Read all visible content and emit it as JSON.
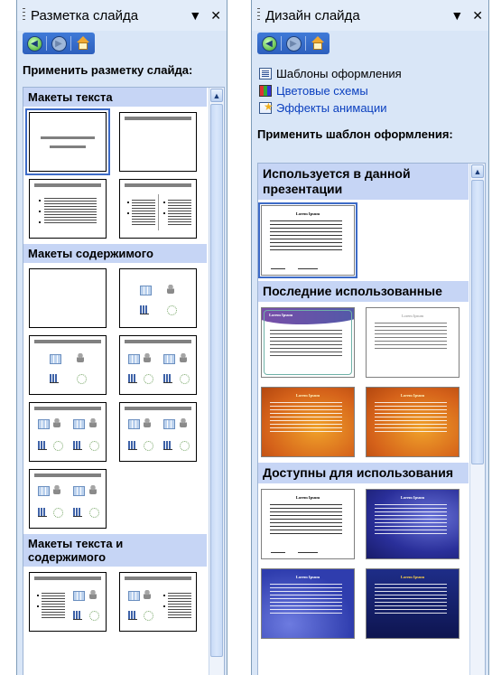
{
  "left_pane": {
    "title": "Разметка слайда",
    "dropdown_glyph": "▼",
    "close_glyph": "✕",
    "apply_label": "Применить разметку слайда:",
    "groups": [
      {
        "label": "Макеты текста"
      },
      {
        "label": "Макеты содержимого"
      },
      {
        "label": "Макеты текста и содержимого"
      }
    ]
  },
  "right_pane": {
    "title": "Дизайн слайда",
    "dropdown_glyph": "▼",
    "close_glyph": "✕",
    "links": [
      {
        "label": "Шаблоны оформления",
        "icon": "templates-icon"
      },
      {
        "label": "Цветовые схемы",
        "icon": "color-schemes-icon"
      },
      {
        "label": "Эффекты анимации",
        "icon": "animation-effects-icon"
      }
    ],
    "apply_label": "Применить шаблон оформления:",
    "groups": [
      {
        "label": "Используется в данной презентации"
      },
      {
        "label": "Последние использованные"
      },
      {
        "label": "Доступны для использования"
      }
    ],
    "design_title": "Lorem Ipsum"
  },
  "nav": {
    "back": "back-icon",
    "forward": "forward-icon",
    "home": "home-icon"
  },
  "colors": {
    "pane_bg": "#d9e6f7",
    "group_header": "#c6d5f5",
    "selection": "#3d6bc7",
    "nav_bar": "#2d5fbd"
  }
}
